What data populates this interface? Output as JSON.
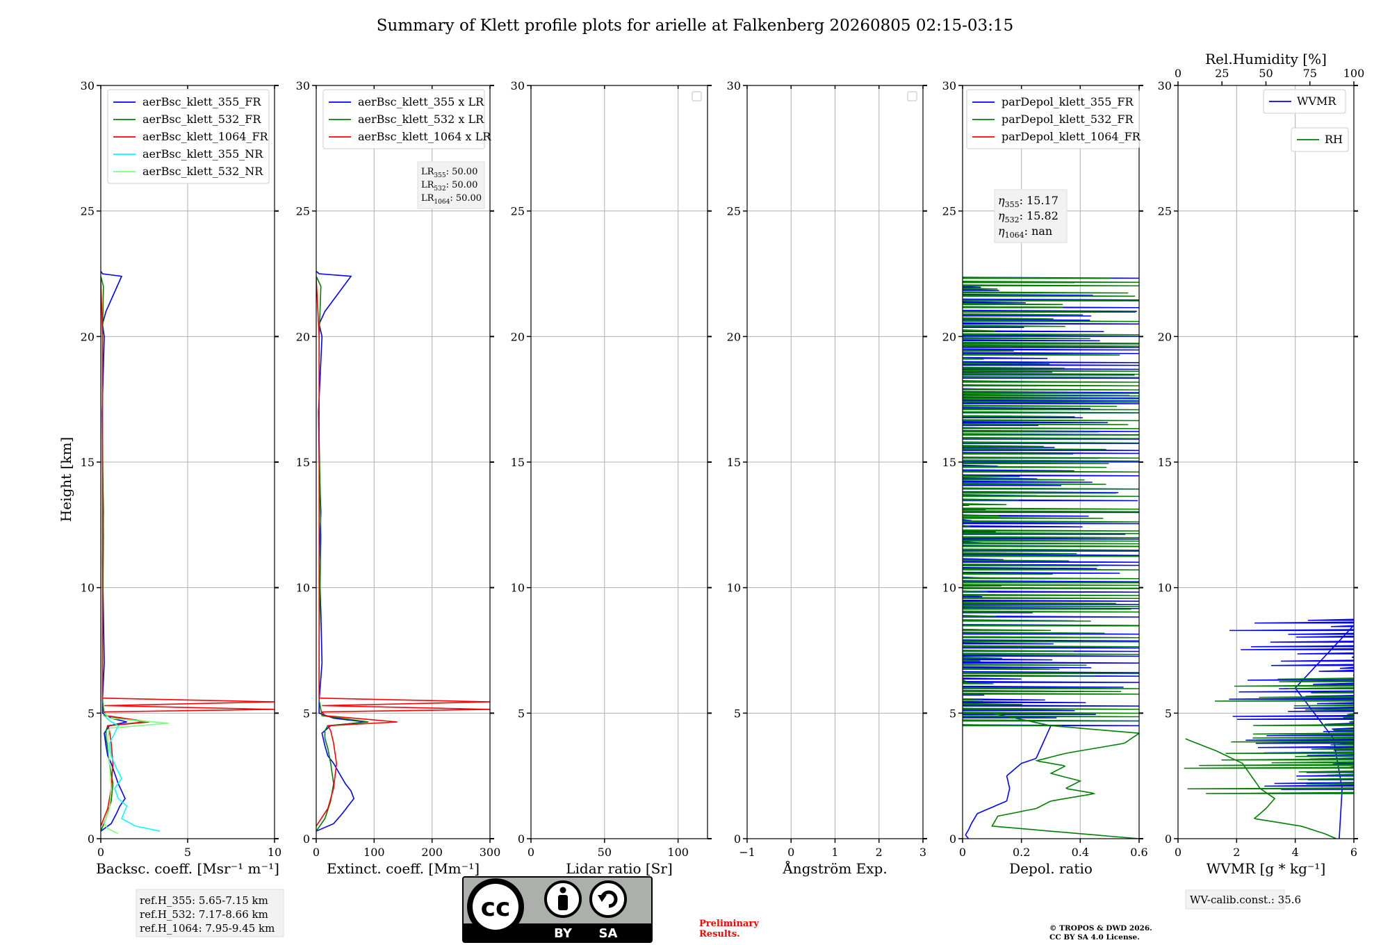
{
  "figure": {
    "title": "Summary of Klett profile plots for arielle at Falkenberg 20260805 02:15-03:15",
    "height_label": "Height [km]",
    "ref_heights": [
      "ref.H_355: 5.65-7.15 km",
      "ref.H_532: 7.17-8.66 km",
      "ref.H_1064: 7.95-9.45 km"
    ],
    "license_badge": {
      "top": "cc",
      "by": "BY",
      "sa": "SA"
    },
    "preliminary": [
      "Preliminary",
      "Results."
    ],
    "copyright": [
      "© TROPOS & DWD 2026.",
      "CC BY SA 4.0 License."
    ],
    "wv_calib": "WV-calib.const.: 35.6",
    "colors": {
      "blue": "#0000ff",
      "green": "#008000",
      "red": "#ff0000",
      "darkred": "#8b0000",
      "cyan": "#00ffff",
      "lightgreen": "#7cfc7c",
      "grid": "#b0b0b0"
    }
  },
  "chart_data": [
    {
      "type": "line",
      "xlabel": "Backsc. coeff. [Msr⁻¹ m⁻¹]",
      "ylabel": "Height [km]",
      "xlim": [
        0,
        10
      ],
      "ylim": [
        0,
        30
      ],
      "xticks": [
        0,
        5,
        10
      ],
      "yticks": [
        0,
        5,
        10,
        15,
        20,
        25,
        30
      ],
      "grid": true,
      "legend": "top-right",
      "series": [
        {
          "name": "aerBsc_klett_355_FR",
          "color": "#0000ff",
          "x": [
            0.0,
            0.6,
            0.9,
            1.1,
            1.4,
            1.2,
            1.0,
            0.8,
            0.6,
            0.4,
            0.3,
            0.2,
            0.5,
            1.5,
            0.6,
            0.1,
            0.1,
            0.2,
            0.15,
            0.1,
            0.15,
            0.1,
            0.08,
            0.2,
            0.1,
            0.3,
            1.2,
            0.1,
            0.0
          ],
          "y": [
            0.3,
            0.6,
            1.0,
            1.3,
            1.6,
            1.9,
            2.2,
            2.6,
            3.0,
            3.3,
            3.7,
            4.2,
            4.5,
            4.65,
            4.8,
            5.0,
            5.5,
            7.0,
            9.0,
            11.0,
            13.0,
            15.0,
            17.0,
            20.0,
            20.5,
            21.0,
            22.4,
            22.5,
            22.6
          ]
        },
        {
          "name": "aerBsc_klett_532_FR",
          "color": "#008000",
          "x": [
            0.0,
            0.3,
            0.6,
            0.7,
            0.5,
            0.4,
            0.3,
            0.3,
            0.4,
            2.5,
            0.2,
            0.1,
            0.1,
            0.15,
            0.1,
            0.1,
            0.15,
            0.0
          ],
          "y": [
            0.3,
            0.8,
            1.5,
            2.2,
            3.0,
            3.6,
            4.0,
            4.3,
            4.5,
            4.65,
            4.9,
            5.5,
            8.0,
            12.0,
            16.0,
            20.0,
            22.0,
            22.4
          ]
        },
        {
          "name": "aerBsc_klett_1064_FR",
          "color": "#ff0000",
          "x": [
            0.0,
            0.4,
            0.6,
            0.7,
            0.6,
            0.5,
            0.4,
            2.8,
            0.3,
            0.2,
            10.0,
            0.2,
            10.0,
            0.1,
            0.1,
            0.1,
            0.0
          ],
          "y": [
            0.5,
            1.2,
            2.0,
            3.0,
            3.8,
            4.3,
            4.5,
            4.65,
            4.9,
            5.05,
            5.15,
            5.3,
            5.45,
            5.6,
            10.0,
            20.0,
            22.3
          ]
        },
        {
          "name": "aerBsc_klett_355_NR",
          "color": "#00ffff",
          "x": [
            3.4,
            2.0,
            1.2,
            1.5,
            1.0,
            0.8,
            1.2,
            0.9,
            0.6,
            0.5,
            0.8,
            1.0,
            0.5,
            0.2
          ],
          "y": [
            0.3,
            0.5,
            0.8,
            1.3,
            1.6,
            2.0,
            2.4,
            2.8,
            3.3,
            3.8,
            4.2,
            4.5,
            4.7,
            4.9
          ]
        },
        {
          "name": "aerBsc_klett_532_NR",
          "color": "#7cfc7c",
          "x": [
            1.0,
            0.4,
            0.2,
            0.5,
            0.6,
            0.5,
            0.4,
            0.5,
            3.9,
            0.5,
            0.2
          ],
          "y": [
            0.2,
            0.4,
            0.6,
            1.2,
            2.0,
            3.0,
            4.0,
            4.4,
            4.6,
            4.8,
            5.0
          ]
        }
      ]
    },
    {
      "type": "line",
      "xlabel": "Extinct. coeff. [Mm⁻¹]",
      "xlim": [
        0,
        300
      ],
      "ylim": [
        0,
        30
      ],
      "xticks": [
        0,
        100,
        200,
        300
      ],
      "yticks": [
        0,
        5,
        10,
        15,
        20,
        25,
        30
      ],
      "grid": true,
      "legend": "top-right",
      "annotation": {
        "lines": [
          {
            "base": "LR",
            "sub": "355",
            "value": ": 50.00"
          },
          {
            "base": "LR",
            "sub": "532",
            "value": ": 50.00"
          },
          {
            "base": "LR",
            "sub": "1064",
            "value": ": 50.00"
          }
        ]
      },
      "series": [
        {
          "name": "aerBsc_klett_355 x LR",
          "color": "#0000ff",
          "x": [
            0,
            30,
            45,
            55,
            65,
            60,
            50,
            40,
            30,
            20,
            15,
            10,
            25,
            85,
            30,
            5,
            5,
            10,
            8,
            5,
            8,
            5,
            4,
            10,
            5,
            15,
            60,
            5,
            0
          ],
          "y": [
            0.3,
            0.6,
            1.0,
            1.3,
            1.6,
            1.9,
            2.2,
            2.6,
            3.0,
            3.3,
            3.7,
            4.2,
            4.5,
            4.65,
            4.8,
            5.0,
            5.5,
            7.0,
            9.0,
            11.0,
            13.0,
            15.0,
            17.0,
            20.0,
            20.5,
            21.0,
            22.4,
            22.5,
            22.6
          ]
        },
        {
          "name": "aerBsc_klett_532 x LR",
          "color": "#008000",
          "x": [
            0,
            15,
            25,
            30,
            25,
            20,
            15,
            15,
            20,
            90,
            10,
            5,
            5,
            8,
            5,
            5,
            8,
            0
          ],
          "y": [
            0.3,
            0.8,
            1.5,
            2.2,
            3.0,
            3.6,
            4.0,
            4.3,
            4.5,
            4.65,
            4.9,
            5.5,
            8.0,
            12.0,
            16.0,
            20.0,
            22.0,
            22.4
          ]
        },
        {
          "name": "aerBsc_klett_1064 x LR",
          "color": "#ff0000",
          "x": [
            0,
            20,
            30,
            35,
            30,
            25,
            20,
            140,
            15,
            10,
            300,
            10,
            300,
            5,
            5,
            5,
            0
          ],
          "y": [
            0.5,
            1.2,
            2.0,
            3.0,
            3.8,
            4.3,
            4.5,
            4.65,
            4.9,
            5.05,
            5.15,
            5.3,
            5.45,
            5.6,
            10.0,
            20.0,
            22.3
          ]
        }
      ]
    },
    {
      "type": "line",
      "xlabel": "Lidar ratio [Sr]",
      "xlim": [
        0,
        120
      ],
      "ylim": [
        0,
        30
      ],
      "xticks": [
        0,
        50,
        100
      ],
      "yticks": [
        0,
        5,
        10,
        15,
        20,
        25,
        30
      ],
      "grid": true,
      "legend": "top-right",
      "series": []
    },
    {
      "type": "line",
      "xlabel": "Ångström Exp.",
      "xlim": [
        -1,
        3
      ],
      "ylim": [
        0,
        30
      ],
      "xticks": [
        -1,
        0,
        1,
        2,
        3
      ],
      "yticks": [
        0,
        5,
        10,
        15,
        20,
        25,
        30
      ],
      "grid": true,
      "legend": "top-right",
      "series": []
    },
    {
      "type": "line",
      "xlabel": "Depol. ratio",
      "xlim": [
        0,
        0.6
      ],
      "ylim": [
        0,
        30
      ],
      "xticks": [
        0.0,
        0.2,
        0.4,
        0.6
      ],
      "yticks": [
        0,
        5,
        10,
        15,
        20,
        25,
        30
      ],
      "grid": true,
      "legend": "top-left",
      "annotation": {
        "lines": [
          {
            "base": "η",
            "sub": "355",
            "value": ": 15.17"
          },
          {
            "base": "η",
            "sub": "532",
            "value": ": 15.82"
          },
          {
            "base": "η",
            "sub": "1064",
            "value": ": nan"
          }
        ]
      },
      "series": [
        {
          "name": "parDepol_klett_355_FR",
          "color": "#0000ff",
          "style": "spiky",
          "profile": {
            "y": [
              0.0,
              0.15,
              0.35,
              0.6,
              1.0,
              1.5,
              2.0,
              2.5,
              2.8,
              3.0,
              3.2,
              4.5,
              5.0
            ],
            "x": [
              0.02,
              0.01,
              0.02,
              0.03,
              0.05,
              0.15,
              0.16,
              0.15,
              0.18,
              0.2,
              0.25,
              0.3,
              0.1
            ]
          },
          "spike_range": [
            4.5,
            22.4
          ],
          "spike_max": 0.6
        },
        {
          "name": "parDepol_klett_532_FR",
          "color": "#008000",
          "style": "spiky",
          "profile": {
            "y": [
              0.0,
              0.5,
              0.9,
              1.2,
              1.5,
              1.8,
              2.0,
              2.3,
              2.6,
              2.9,
              3.1,
              3.4,
              3.8,
              4.2,
              4.5,
              5.0
            ],
            "x": [
              0.6,
              0.1,
              0.12,
              0.25,
              0.3,
              0.45,
              0.35,
              0.4,
              0.3,
              0.35,
              0.25,
              0.35,
              0.55,
              0.6,
              0.3,
              0.1
            ]
          },
          "spike_range": [
            4.5,
            22.4
          ],
          "spike_max": 0.6
        },
        {
          "name": "parDepol_klett_1064_FR",
          "color": "#ff0000",
          "x": [],
          "y": []
        }
      ]
    },
    {
      "type": "line",
      "xlabel": "WVMR [g * kg⁻¹]",
      "top_xlabel": "Rel.Humidity [%]",
      "xlim": [
        0,
        6
      ],
      "top_xlim": [
        0,
        100
      ],
      "ylim": [
        0,
        30
      ],
      "xticks": [
        0,
        2,
        4,
        6
      ],
      "top_xticks": [
        0,
        25,
        50,
        75,
        100
      ],
      "yticks": [
        0,
        5,
        10,
        15,
        20,
        25,
        30
      ],
      "grid": true,
      "legend": "top-right",
      "series": [
        {
          "name": "WVMR",
          "color": "#0000ff",
          "style": "spiky",
          "profile": {
            "y": [
              0.0,
              2.0,
              4.0,
              6.0,
              8.5
            ],
            "x": [
              5.5,
              5.6,
              5.3,
              4.0,
              6.0
            ]
          },
          "spike_range": [
            1.8,
            8.8
          ],
          "spike_min": 1.7
        },
        {
          "name": "RH",
          "color": "#008000",
          "style": "spiky",
          "profile": {
            "y": [
              0.0,
              0.2,
              0.5,
              0.8,
              1.2,
              1.6,
              2.0,
              2.5,
              3.0,
              3.5,
              4.0
            ],
            "x": [
              5.4,
              5.0,
              4.2,
              2.6,
              3.0,
              3.3,
              2.8,
              2.5,
              2.2,
              1.3,
              0.2
            ]
          },
          "spike_range": [
            1.8,
            6.5
          ],
          "spike_min": 0.2
        }
      ]
    }
  ]
}
